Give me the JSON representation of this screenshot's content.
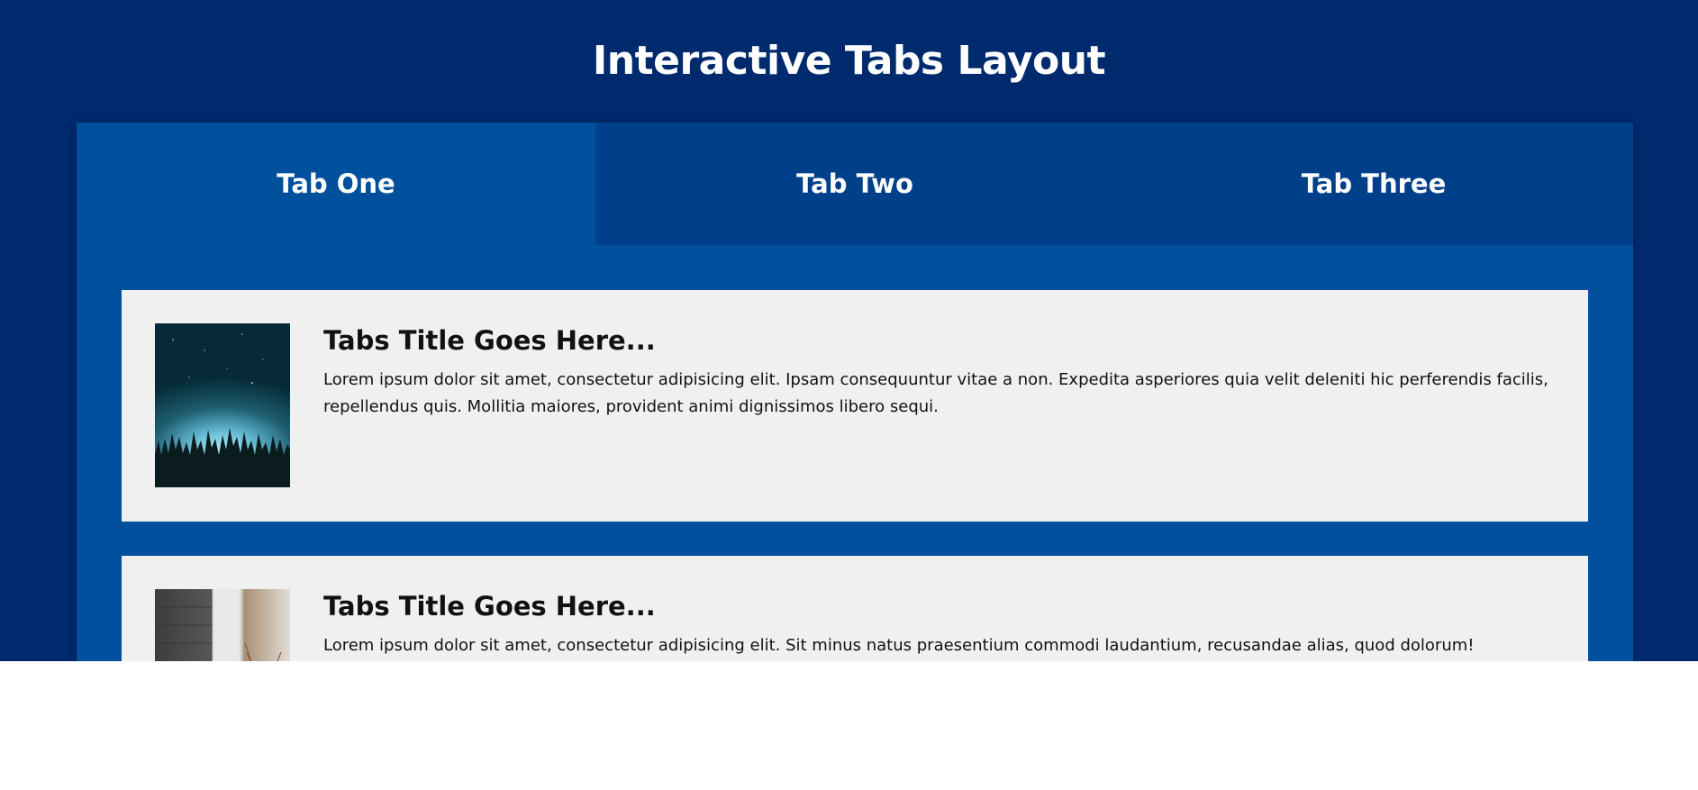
{
  "page": {
    "title": "Interactive Tabs Layout"
  },
  "tabs": [
    {
      "label": "Tab One",
      "active": true
    },
    {
      "label": "Tab Two",
      "active": false
    },
    {
      "label": "Tab Three",
      "active": false
    }
  ],
  "cards": [
    {
      "title": "Tabs Title Goes Here...",
      "text": "Lorem ipsum dolor sit amet, consectetur adipisicing elit. Ipsam consequuntur vitae a non. Expedita asperiores quia velit deleniti hic perferendis facilis, repellendus quis. Mollitia maiores, provident animi dignissimos libero sequi.",
      "image": "night-forest-sky-image"
    },
    {
      "title": "Tabs Title Goes Here...",
      "text": "Lorem ipsum dolor sit amet, consectetur adipisicing elit. Sit minus natus praesentium commodi laudantium, recusandae alias, quod dolorum! Asperiores",
      "image": "building-tree-image"
    }
  ],
  "colors": {
    "page_background": "#002a6e",
    "tab_panel": "#00509e",
    "tab_inactive": "#003f8a",
    "card_background": "#f0f0f0"
  }
}
